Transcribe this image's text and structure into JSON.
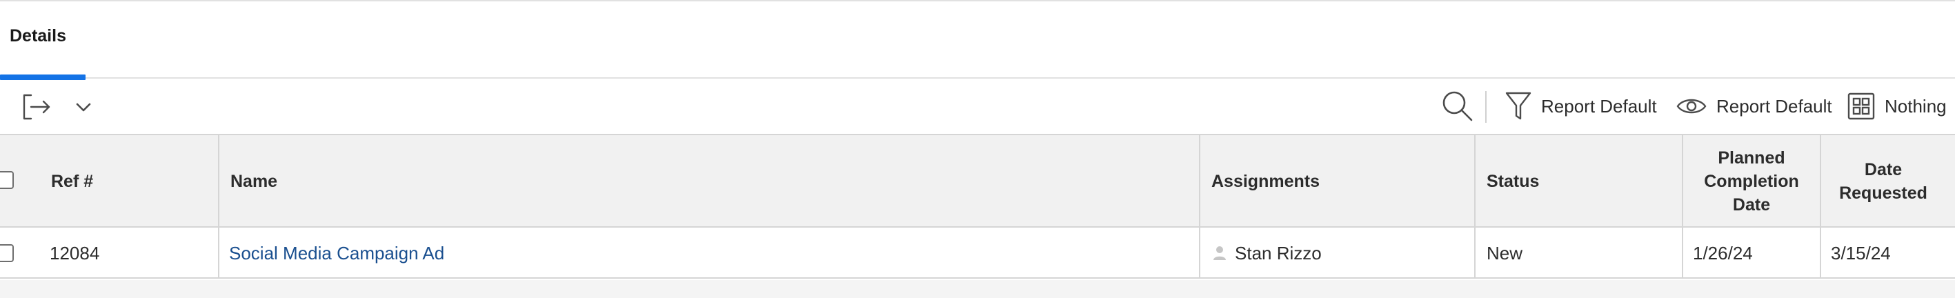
{
  "tabs": [
    {
      "label": "Details",
      "active": true
    }
  ],
  "toolbar": {
    "export_icon": "export-arrow-icon",
    "dropdown_icon": "chevron-down-icon",
    "search_icon": "search-icon",
    "filter": {
      "icon": "filter-icon",
      "label": "Report Default"
    },
    "view": {
      "icon": "eye-icon",
      "label": "Report Default"
    },
    "grouping": {
      "icon": "grid-icon",
      "label": "Nothing"
    }
  },
  "table": {
    "columns": [
      {
        "key": "select",
        "label": ""
      },
      {
        "key": "ref",
        "label": "Ref #"
      },
      {
        "key": "name",
        "label": "Name"
      },
      {
        "key": "assignments",
        "label": "Assignments"
      },
      {
        "key": "status",
        "label": "Status"
      },
      {
        "key": "planned",
        "label": "Planned Completion Date"
      },
      {
        "key": "requested",
        "label": "Date Requested"
      }
    ],
    "rows": [
      {
        "ref": "12084",
        "name": "Social Media Campaign Ad",
        "assignments": "Stan Rizzo",
        "status": "New",
        "planned": "1/26/24",
        "requested": "3/15/24"
      }
    ]
  },
  "colors": {
    "accent": "#1473e6",
    "link": "#1a4f8f",
    "header_bg": "#f1f1f1",
    "border": "#d5d5d5"
  }
}
